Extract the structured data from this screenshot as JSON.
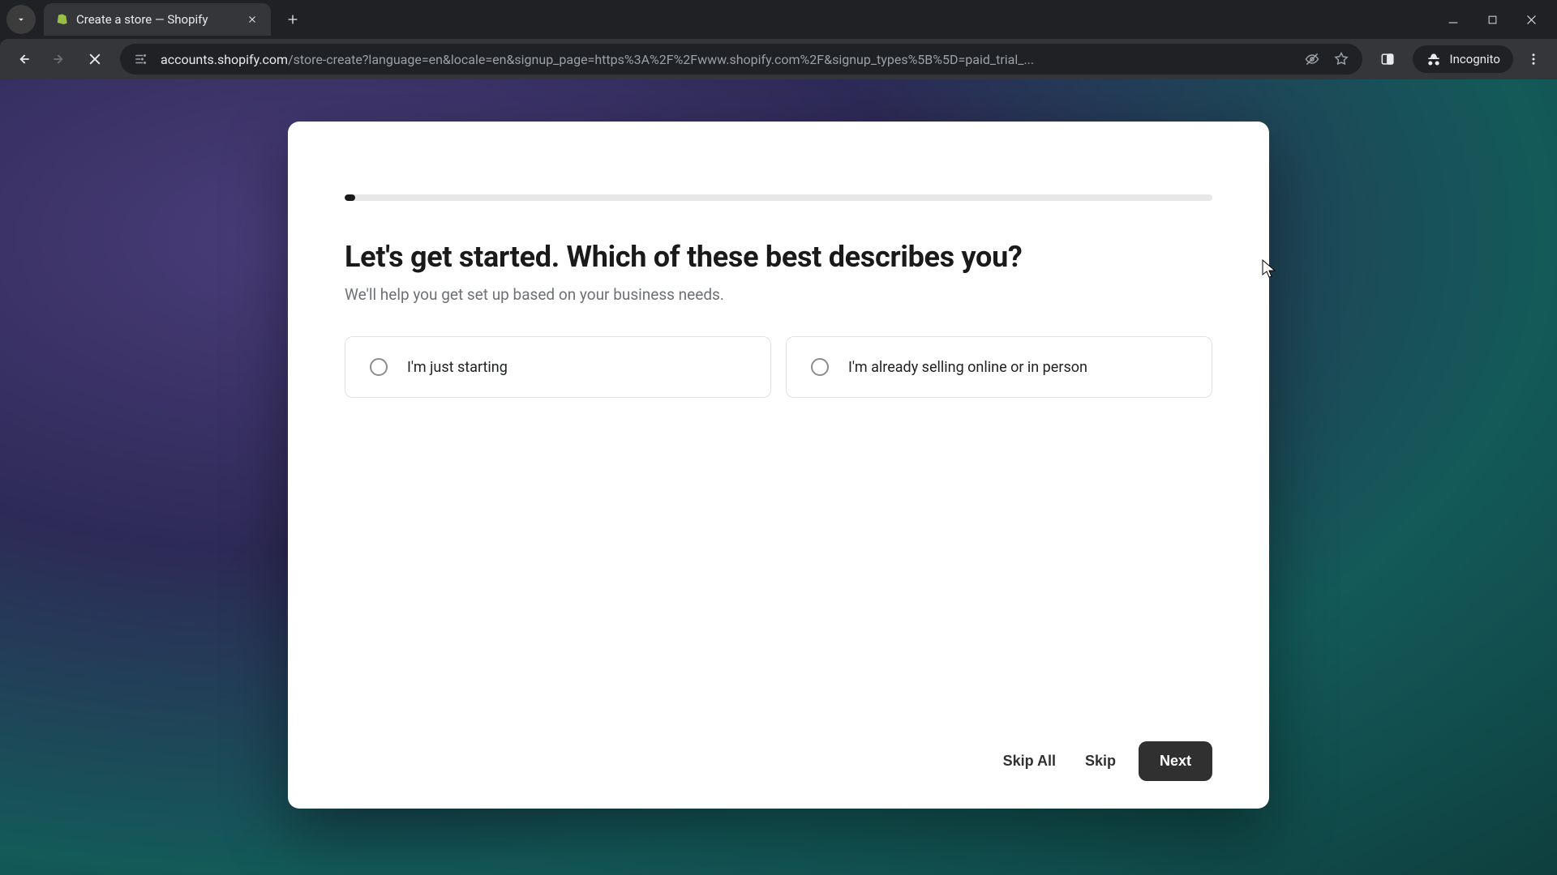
{
  "browser": {
    "tab_title": "Create a store — Shopify",
    "url_host": "accounts.shopify.com",
    "url_path": "/store-create?language=en&locale=en&signup_page=https%3A%2F%2Fwww.shopify.com%2F&signup_types%5B%5D=paid_trial_...",
    "incognito_label": "Incognito"
  },
  "modal": {
    "heading": "Let's get started. Which of these best describes you?",
    "subheading": "We'll help you get set up based on your business needs.",
    "options": [
      {
        "label": "I'm just starting"
      },
      {
        "label": "I'm already selling online or in person"
      }
    ],
    "footer": {
      "skip_all": "Skip All",
      "skip": "Skip",
      "next": "Next"
    }
  }
}
